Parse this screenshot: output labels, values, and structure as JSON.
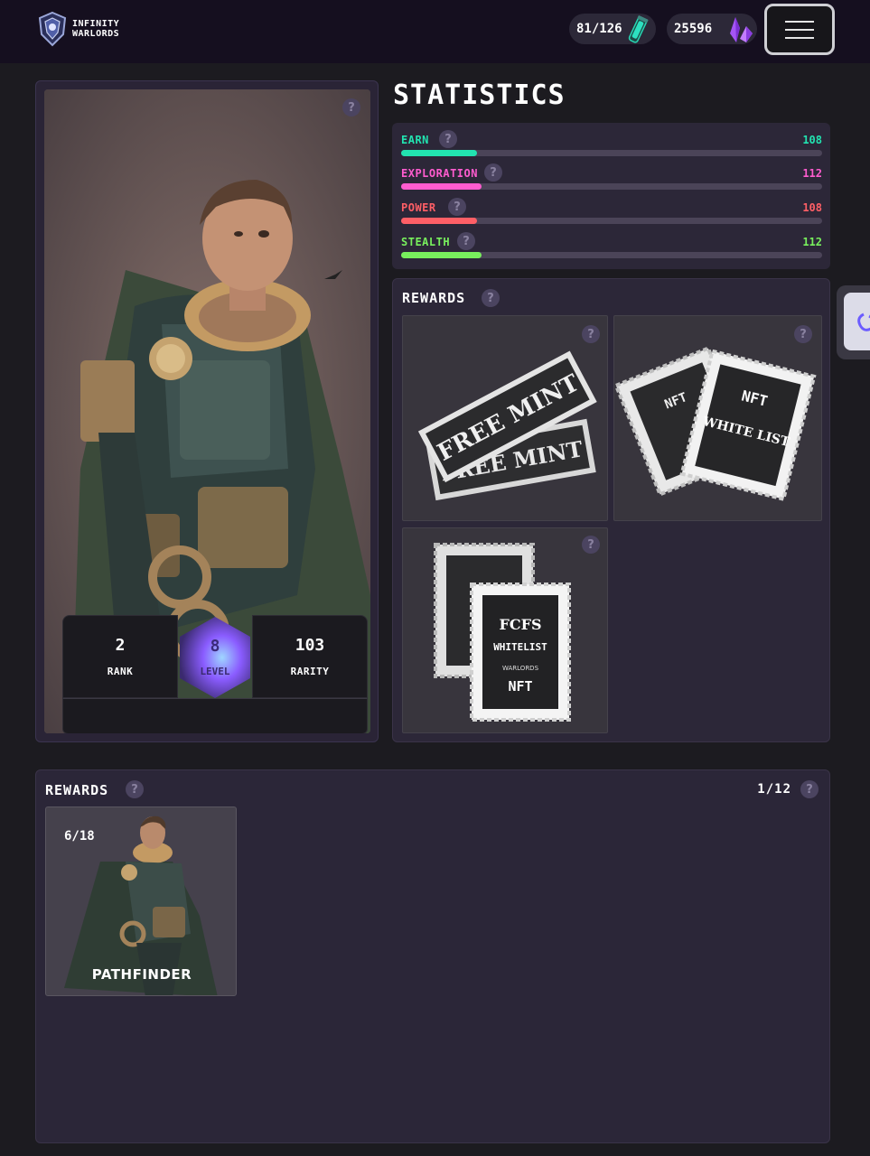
{
  "header": {
    "logo_line1": "INFINITY",
    "logo_line2": "WARLORDS",
    "energy": "81/126",
    "energy_icon": "energy-canister-icon",
    "gems": "25596",
    "gems_icon": "purple-crystal-icon",
    "menu_icon": "hamburger-icon"
  },
  "character": {
    "rank_value": "2",
    "rank_label": "RANK",
    "level_value": "8",
    "level_label": "LEVEL",
    "rarity_value": "103",
    "rarity_label": "RARITY"
  },
  "statistics": {
    "title": "STATISTICS",
    "rows": [
      {
        "name": "EARN",
        "value": "108",
        "color": "#22e3b0",
        "fill": 0.18
      },
      {
        "name": "EXPLORATION",
        "value": "112",
        "color": "#ff5ccf",
        "fill": 0.19
      },
      {
        "name": "POWER",
        "value": "108",
        "color": "#ff5f66",
        "fill": 0.18
      },
      {
        "name": "STEALTH",
        "value": "112",
        "color": "#78ef5d",
        "fill": 0.19
      }
    ]
  },
  "rewards": {
    "title": "REWARDS",
    "tiles": [
      {
        "name": "free-mint-tickets",
        "text_a": "FREE MINT",
        "text_b": "FREE MINT"
      },
      {
        "name": "nft-whitelist-stamps",
        "text_a": "NFT",
        "text_b": "WHITE LIST"
      },
      {
        "name": "fcfs-whitelist-stamps",
        "text_a": "FCFS",
        "text_b": "WHITELIST",
        "text_c": "WARLORDS",
        "text_d": "NFT"
      }
    ]
  },
  "bottom_rewards": {
    "title": "REWARDS",
    "count": "1/12",
    "card": {
      "progress": "6/18",
      "name": "PATHFINDER"
    }
  },
  "colors": {
    "bg": "#1c1b20",
    "topbar": "#150f1f",
    "panel": "#2c2738",
    "level_glow": "#8a5cff"
  }
}
